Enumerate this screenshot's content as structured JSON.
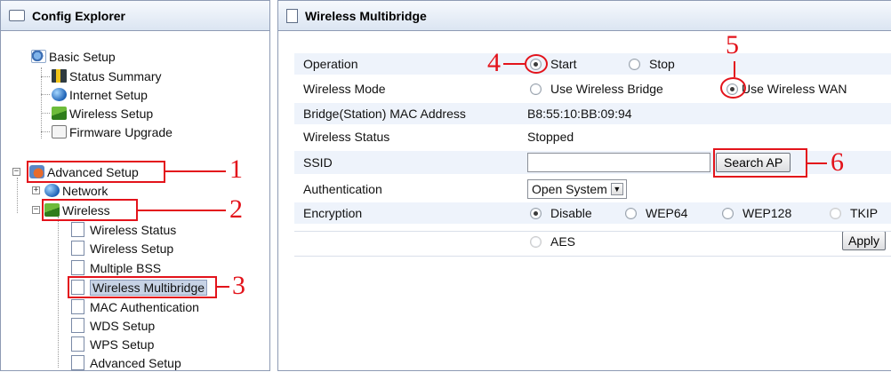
{
  "left": {
    "title": "Config Explorer",
    "tree": {
      "basic_setup": "Basic Setup",
      "status_summary": "Status Summary",
      "internet_setup": "Internet Setup",
      "wireless_setup_basic": "Wireless Setup",
      "firmware_upgrade": "Firmware Upgrade",
      "advanced_setup": "Advanced Setup",
      "network": "Network",
      "wireless": "Wireless",
      "wireless_children": [
        "Wireless Status",
        "Wireless Setup",
        "Multiple BSS",
        "Wireless Multibridge",
        "MAC Authentication",
        "WDS Setup",
        "WPS Setup",
        "Advanced Setup"
      ]
    }
  },
  "right": {
    "title": "Wireless Multibridge",
    "form": {
      "operation": {
        "label": "Operation",
        "opt1": "Start",
        "opt2": "Stop",
        "selected": "Start"
      },
      "wireless_mode": {
        "label": "Wireless Mode",
        "opt1": "Use Wireless Bridge",
        "opt2": "Use Wireless WAN",
        "selected": "Use Wireless WAN"
      },
      "mac": {
        "label": "Bridge(Station) MAC Address",
        "value": "B8:55:10:BB:09:94"
      },
      "status": {
        "label": "Wireless Status",
        "value": "Stopped"
      },
      "ssid": {
        "label": "SSID",
        "value": "",
        "button": "Search AP"
      },
      "auth": {
        "label": "Authentication",
        "value": "Open System"
      },
      "encryption": {
        "label": "Encryption",
        "opt1": "Disable",
        "opt2": "WEP64",
        "opt3": "WEP128",
        "opt4": "TKIP",
        "opt5": "AES",
        "selected": "Disable"
      },
      "apply": "Apply"
    }
  },
  "annotations": [
    "1",
    "2",
    "3",
    "4",
    "5",
    "6"
  ],
  "colors": {
    "annotation": "#e3131b",
    "header_bg": "#dbe5f2",
    "row_shade": "#eef3fb",
    "selected": "#c7d3e6"
  }
}
